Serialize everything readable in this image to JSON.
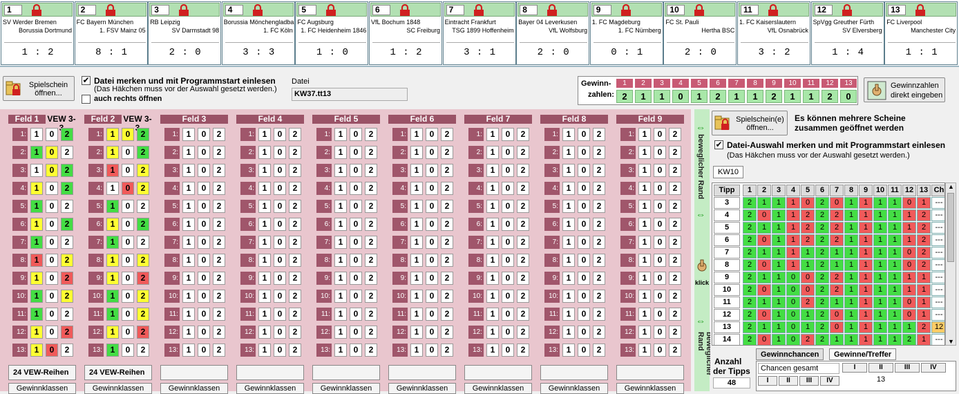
{
  "matches": [
    {
      "num": "1",
      "home": "SV Werder Bremen",
      "away": "Borussia Dortmund",
      "result": "1 : 2"
    },
    {
      "num": "2",
      "home": "FC Bayern München",
      "away": "1. FSV Mainz 05",
      "result": "8 : 1"
    },
    {
      "num": "3",
      "home": "RB Leipzig",
      "away": "SV Darmstadt 98",
      "result": "2 : 0"
    },
    {
      "num": "4",
      "home": "Borussia Mönchengladba",
      "away": "1. FC Köln",
      "result": "3 : 3"
    },
    {
      "num": "5",
      "home": "FC Augsburg",
      "away": "1. FC Heidenheim 1846",
      "result": "1 : 0"
    },
    {
      "num": "6",
      "home": "VfL Bochum 1848",
      "away": "SC Freiburg",
      "result": "1 : 2"
    },
    {
      "num": "7",
      "home": "Eintracht Frankfurt",
      "away": "TSG 1899 Hoffenheim",
      "result": "3 : 1"
    },
    {
      "num": "8",
      "home": "Bayer 04 Leverkusen",
      "away": "VfL Wolfsburg",
      "result": "2 : 0"
    },
    {
      "num": "9",
      "home": "1. FC Magdeburg",
      "away": "1. FC Nürnberg",
      "result": "0 : 1"
    },
    {
      "num": "10",
      "home": "FC St. Pauli",
      "away": "Hertha BSC",
      "result": "2 : 0"
    },
    {
      "num": "11",
      "home": "1. FC Kaiserslautern",
      "away": "VfL Osnabrück",
      "result": "3 : 2"
    },
    {
      "num": "12",
      "home": "SpVgg Greuther Fürth",
      "away": "SV Elversberg",
      "result": "1 : 4"
    },
    {
      "num": "13",
      "home": "FC Liverpool",
      "away": "Manchester City",
      "result": "1 : 1"
    }
  ],
  "topbar": {
    "open_btn": "Spielschein öffnen...",
    "remember_label": "Datei merken und mit Programmstart einlesen",
    "remember_note": "(Das Häkchen muss vor der Auswahl gesetzt werden.)",
    "remember_checked": "✔",
    "right_open_label": "auch rechts öffnen",
    "file_label": "Datei",
    "file_value": "KW37.tt13",
    "gewinn_label1": "Gewinn-",
    "gewinn_label2": "zahlen:",
    "win_numbers": [
      "1",
      "2",
      "3",
      "4",
      "5",
      "6",
      "7",
      "8",
      "9",
      "10",
      "11",
      "12",
      "13"
    ],
    "win_values": [
      "2",
      "1",
      "1",
      "0",
      "1",
      "2",
      "1",
      "1",
      "2",
      "1",
      "1",
      "2",
      "0"
    ],
    "direct_btn1": "Gewinnzahlen",
    "direct_btn2": "direkt eingeben"
  },
  "fields": [
    {
      "title": "Feld 1",
      "sub": "VEW 3-3",
      "vew": "24 VEW-Reihen",
      "gk": "Gewinnklassen",
      "rows": [
        [
          "w",
          "w",
          "g"
        ],
        [
          "g",
          "y",
          "w"
        ],
        [
          "w",
          "y",
          "g"
        ],
        [
          "y",
          "w",
          "g"
        ],
        [
          "g",
          "w",
          "w"
        ],
        [
          "y",
          "w",
          "g"
        ],
        [
          "g",
          "w",
          "w"
        ],
        [
          "r",
          "w",
          "y"
        ],
        [
          "y",
          "w",
          "r"
        ],
        [
          "g",
          "w",
          "y"
        ],
        [
          "g",
          "w",
          "w"
        ],
        [
          "y",
          "w",
          "r"
        ],
        [
          "y",
          "r",
          "w"
        ]
      ]
    },
    {
      "title": "Feld 2",
      "sub": "VEW 3-3",
      "vew": "24 VEW-Reihen",
      "gk": "Gewinnklassen",
      "rows": [
        [
          "y",
          "y",
          "g"
        ],
        [
          "y",
          "w",
          "g"
        ],
        [
          "r",
          "w",
          "y"
        ],
        [
          "w",
          "r",
          "y"
        ],
        [
          "g",
          "w",
          "w"
        ],
        [
          "y",
          "w",
          "g"
        ],
        [
          "g",
          "w",
          "w"
        ],
        [
          "y",
          "w",
          "y"
        ],
        [
          "y",
          "w",
          "r"
        ],
        [
          "g",
          "w",
          "y"
        ],
        [
          "g",
          "w",
          "y"
        ],
        [
          "y",
          "w",
          "r"
        ],
        [
          "g",
          "w",
          "w"
        ]
      ]
    },
    {
      "title": "Feld 3",
      "sub": "",
      "vew": "",
      "gk": "Gewinnklassen",
      "rows": []
    },
    {
      "title": "Feld 4",
      "sub": "",
      "vew": "",
      "gk": "Gewinnklassen",
      "rows": []
    },
    {
      "title": "Feld 5",
      "sub": "",
      "vew": "",
      "gk": "Gewinnklassen",
      "rows": []
    },
    {
      "title": "Feld 6",
      "sub": "",
      "vew": "",
      "gk": "Gewinnklassen",
      "rows": []
    },
    {
      "title": "Feld 7",
      "sub": "",
      "vew": "",
      "gk": "Gewinnklassen",
      "rows": []
    },
    {
      "title": "Feld 8",
      "sub": "",
      "vew": "",
      "gk": "Gewinnklassen",
      "rows": []
    },
    {
      "title": "Feld 9",
      "sub": "",
      "vew": "",
      "gk": "Gewinnklassen",
      "rows": []
    }
  ],
  "tip_labels": [
    "1",
    "0",
    "2"
  ],
  "divider": {
    "label_top": "beweglicher Rand",
    "click": "klick",
    "label_bottom": "beweglicher Rand"
  },
  "right": {
    "open_btn": "Spielschein(e) öffnen...",
    "multi_note1": "Es können mehrere Scheine",
    "multi_note2": "zusammen geöffnet werden",
    "remember_label": "Datei-Auswahl merken und mit Programmstart einlesen",
    "remember_note": "(Das Häkchen muss vor der Auswahl gesetzt werden.)",
    "remember_checked": "✔",
    "tab": "KW10",
    "col_tipp": "Tipp",
    "col_ch": "Ch",
    "cols": [
      "1",
      "2",
      "3",
      "4",
      "5",
      "6",
      "7",
      "8",
      "9",
      "10",
      "11",
      "12",
      "13"
    ],
    "tipps": [
      {
        "n": "3",
        "v": [
          "2",
          "1",
          "1",
          "1",
          "0",
          "2",
          "0",
          "1",
          "1",
          "1",
          "1",
          "0",
          "1"
        ],
        "c": [
          "g",
          "g",
          "g",
          "r",
          "r",
          "g",
          "r",
          "g",
          "r",
          "g",
          "g",
          "r",
          "r"
        ],
        "ch": "---"
      },
      {
        "n": "4",
        "v": [
          "2",
          "0",
          "1",
          "1",
          "2",
          "2",
          "2",
          "1",
          "1",
          "1",
          "1",
          "1",
          "2"
        ],
        "c": [
          "g",
          "r",
          "g",
          "r",
          "r",
          "g",
          "r",
          "g",
          "r",
          "g",
          "g",
          "r",
          "r"
        ],
        "ch": "---"
      },
      {
        "n": "5",
        "v": [
          "2",
          "1",
          "1",
          "1",
          "2",
          "2",
          "2",
          "1",
          "1",
          "1",
          "1",
          "1",
          "2"
        ],
        "c": [
          "g",
          "g",
          "g",
          "r",
          "r",
          "g",
          "r",
          "g",
          "r",
          "g",
          "g",
          "r",
          "r"
        ],
        "ch": "---"
      },
      {
        "n": "6",
        "v": [
          "2",
          "0",
          "1",
          "1",
          "2",
          "2",
          "2",
          "1",
          "1",
          "1",
          "1",
          "1",
          "2"
        ],
        "c": [
          "g",
          "r",
          "g",
          "r",
          "r",
          "g",
          "r",
          "g",
          "r",
          "g",
          "g",
          "r",
          "r"
        ],
        "ch": "---"
      },
      {
        "n": "7",
        "v": [
          "2",
          "1",
          "1",
          "1",
          "1",
          "2",
          "1",
          "1",
          "1",
          "1",
          "1",
          "0",
          "2"
        ],
        "c": [
          "g",
          "g",
          "g",
          "r",
          "g",
          "g",
          "g",
          "g",
          "r",
          "g",
          "g",
          "r",
          "r"
        ],
        "ch": "---"
      },
      {
        "n": "8",
        "v": [
          "2",
          "0",
          "1",
          "1",
          "1",
          "2",
          "1",
          "1",
          "1",
          "1",
          "1",
          "0",
          "2"
        ],
        "c": [
          "g",
          "r",
          "g",
          "r",
          "g",
          "g",
          "g",
          "g",
          "r",
          "g",
          "g",
          "r",
          "r"
        ],
        "ch": "---"
      },
      {
        "n": "9",
        "v": [
          "2",
          "1",
          "1",
          "0",
          "0",
          "2",
          "2",
          "1",
          "1",
          "1",
          "1",
          "1",
          "1"
        ],
        "c": [
          "g",
          "g",
          "g",
          "g",
          "r",
          "g",
          "r",
          "g",
          "r",
          "g",
          "g",
          "r",
          "r"
        ],
        "ch": "---"
      },
      {
        "n": "10",
        "v": [
          "2",
          "0",
          "1",
          "0",
          "0",
          "2",
          "2",
          "1",
          "1",
          "1",
          "1",
          "1",
          "1"
        ],
        "c": [
          "g",
          "r",
          "g",
          "g",
          "r",
          "g",
          "r",
          "g",
          "r",
          "g",
          "g",
          "r",
          "r"
        ],
        "ch": "---"
      },
      {
        "n": "11",
        "v": [
          "2",
          "1",
          "1",
          "0",
          "2",
          "2",
          "1",
          "1",
          "1",
          "1",
          "1",
          "0",
          "1"
        ],
        "c": [
          "g",
          "g",
          "g",
          "g",
          "r",
          "g",
          "g",
          "g",
          "r",
          "g",
          "g",
          "r",
          "r"
        ],
        "ch": "---"
      },
      {
        "n": "12",
        "v": [
          "2",
          "0",
          "1",
          "0",
          "1",
          "2",
          "0",
          "1",
          "1",
          "1",
          "1",
          "0",
          "1"
        ],
        "c": [
          "g",
          "r",
          "g",
          "g",
          "g",
          "g",
          "r",
          "g",
          "r",
          "g",
          "g",
          "r",
          "r"
        ],
        "ch": "---"
      },
      {
        "n": "13",
        "v": [
          "2",
          "1",
          "1",
          "0",
          "1",
          "2",
          "0",
          "1",
          "1",
          "1",
          "1",
          "1",
          "2"
        ],
        "c": [
          "g",
          "g",
          "g",
          "g",
          "g",
          "g",
          "r",
          "g",
          "r",
          "g",
          "g",
          "g",
          "r"
        ],
        "ch": "12"
      },
      {
        "n": "14",
        "v": [
          "2",
          "0",
          "1",
          "0",
          "2",
          "2",
          "1",
          "1",
          "1",
          "1",
          "1",
          "2",
          "1"
        ],
        "c": [
          "g",
          "r",
          "g",
          "g",
          "r",
          "g",
          "g",
          "g",
          "r",
          "g",
          "g",
          "g",
          "r"
        ],
        "ch": "---"
      }
    ],
    "anzahl_label1": "Anzahl",
    "anzahl_label2": "der Tipps",
    "anzahl_value": "48",
    "tab_chances": "Gewinnchancen",
    "tab_wins": "Gewinne/Treffer",
    "chances_total": "Chancen gesamt",
    "classes": [
      "I",
      "II",
      "III",
      "IV"
    ],
    "class_value_ii": "13"
  }
}
